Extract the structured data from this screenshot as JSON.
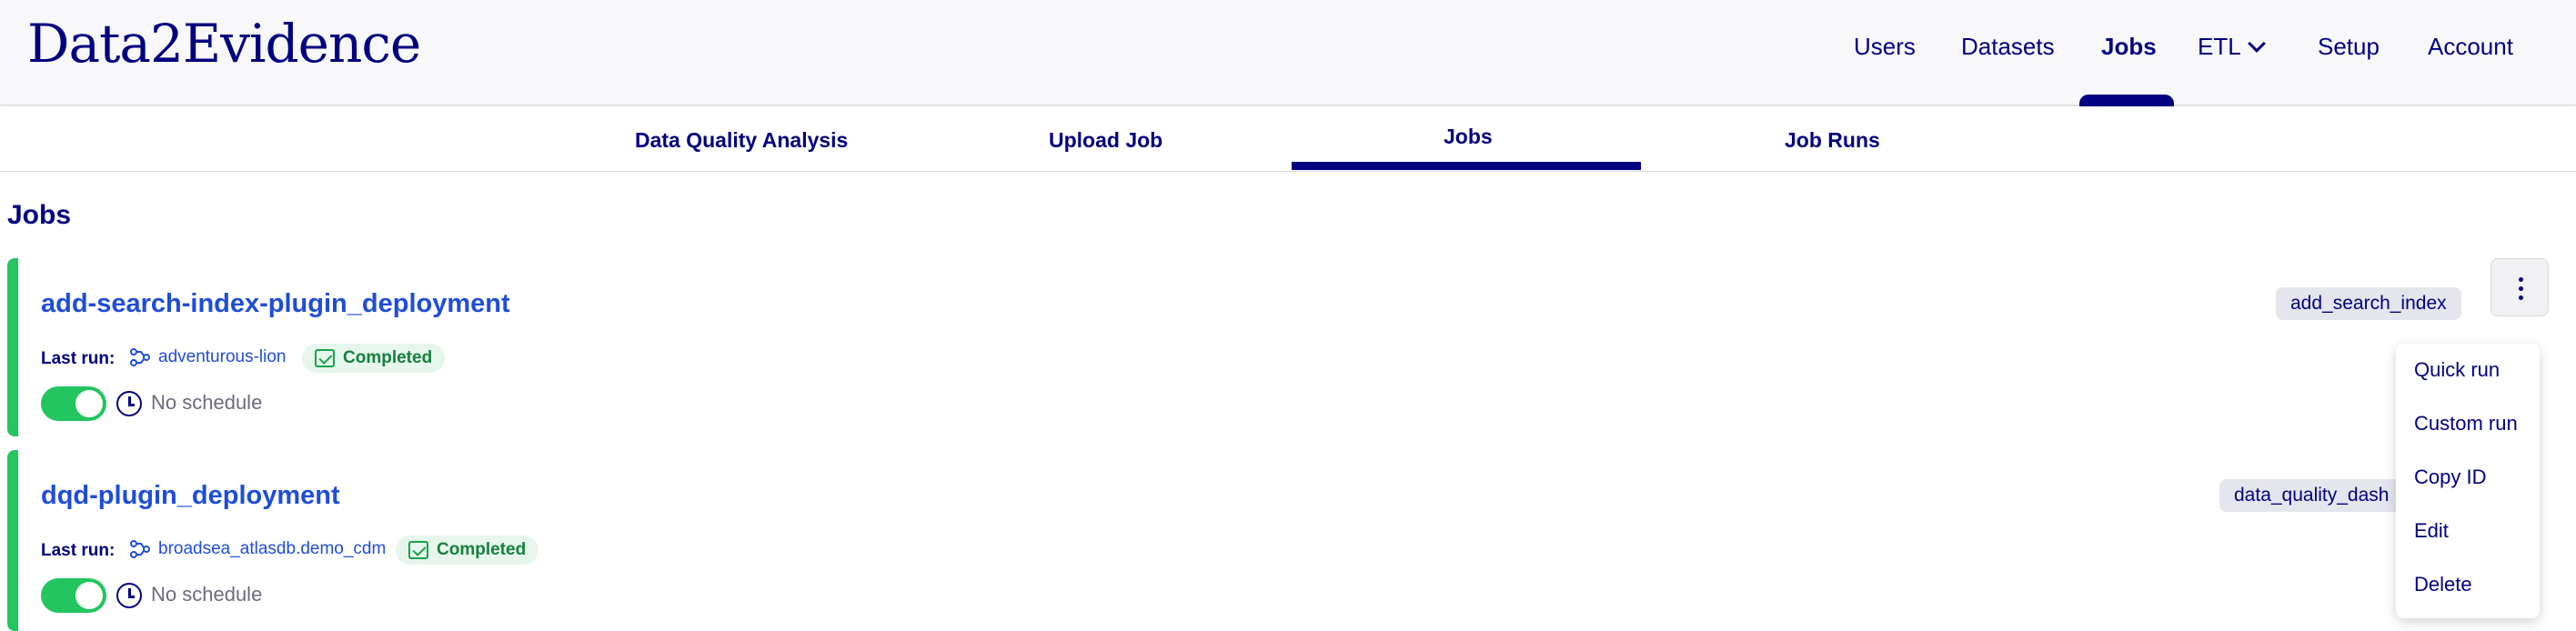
{
  "app": {
    "logo": "Data2Evidence"
  },
  "nav": {
    "items": [
      {
        "label": "Users"
      },
      {
        "label": "Datasets"
      },
      {
        "label": "Jobs",
        "active": true
      },
      {
        "label": "ETL"
      },
      {
        "label": "Setup"
      },
      {
        "label": "Account"
      }
    ]
  },
  "subtabs": [
    {
      "label": "Data Quality Analysis"
    },
    {
      "label": "Upload Job"
    },
    {
      "label": "Jobs",
      "active": true
    },
    {
      "label": "Job Runs"
    }
  ],
  "page": {
    "title": "Jobs"
  },
  "jobs": [
    {
      "name": "add-search-index-plugin_deployment",
      "last_run_label": "Last run:",
      "last_run_name": "adventurous-lion",
      "status": "Completed",
      "schedule": "No schedule",
      "enabled": true,
      "tag": "add_search_index"
    },
    {
      "name": "dqd-plugin_deployment",
      "last_run_label": "Last run:",
      "last_run_name": "broadsea_atlasdb.demo_cdm",
      "status": "Completed",
      "schedule": "No schedule",
      "enabled": true,
      "tag": "data_quality_dash"
    }
  ],
  "menu": {
    "items": [
      "Quick run",
      "Custom run",
      "Copy ID",
      "Edit",
      "Delete"
    ]
  },
  "colors": {
    "primary": "#000080",
    "link": "#1f4dd8",
    "success": "#22c55e",
    "success_text": "#15803d"
  }
}
